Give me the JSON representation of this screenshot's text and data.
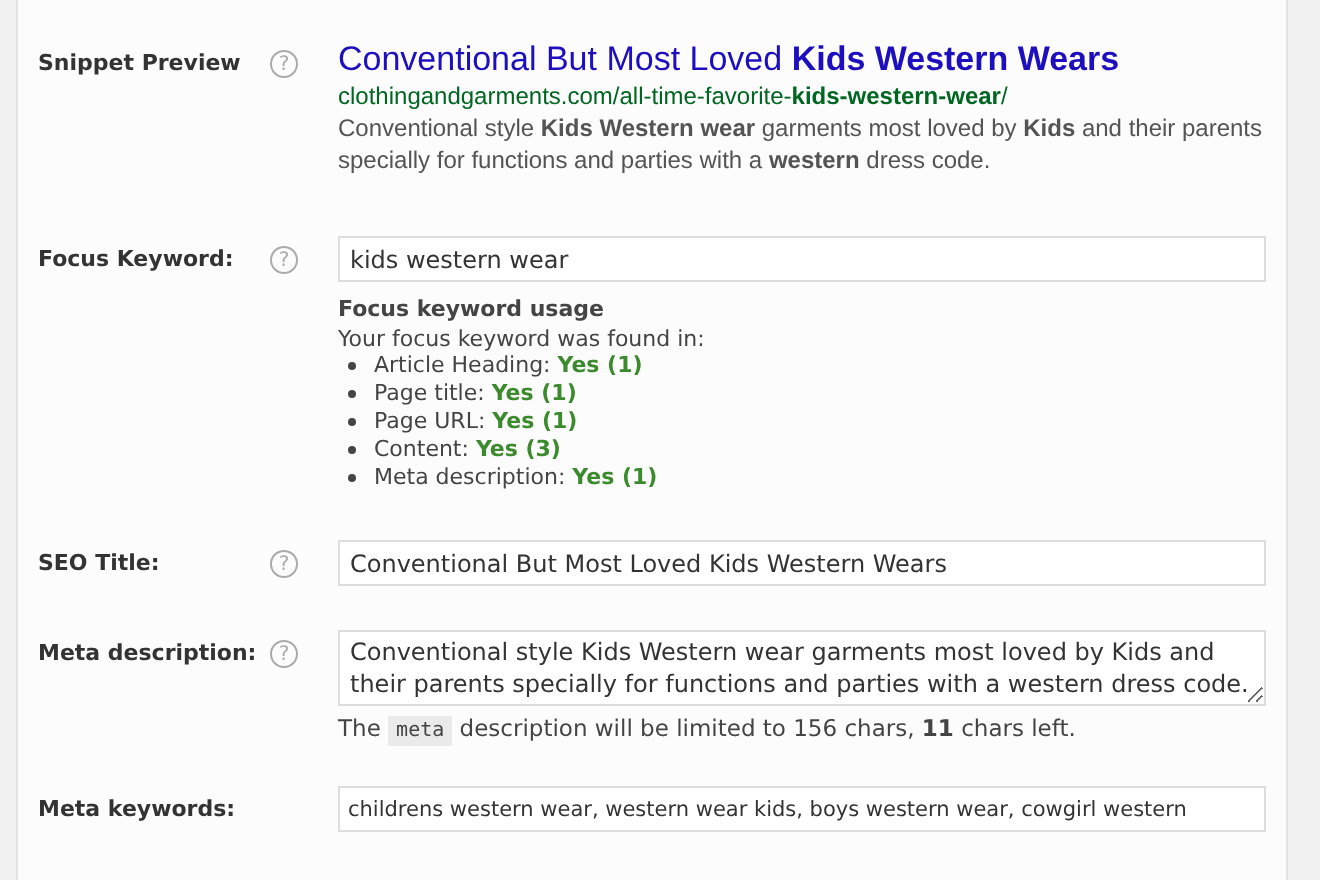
{
  "snippet_preview": {
    "label": "Snippet Preview",
    "help": "?",
    "title": "Conventional But Most Loved **Kids Western Wears**",
    "url": "clothingandgarments.com/all-time-favorite-**kids-western-wear**/",
    "description": "Conventional style **Kids Western wear** garments most loved by **Kids** and their parents specially for functions and parties with a **western** dress code."
  },
  "focus_keyword": {
    "label": "Focus Keyword:",
    "help": "?",
    "value": "kids western wear",
    "usage_heading": "Focus keyword usage",
    "usage_intro": "Your focus keyword was found in:",
    "usage": [
      {
        "label": "Article Heading:",
        "result": "Yes (1)"
      },
      {
        "label": "Page title:",
        "result": "Yes (1)"
      },
      {
        "label": "Page URL:",
        "result": "Yes (1)"
      },
      {
        "label": "Content:",
        "result": "Yes (3)"
      },
      {
        "label": "Meta description:",
        "result": "Yes (1)"
      }
    ]
  },
  "seo_title": {
    "label": "SEO Title:",
    "help": "?",
    "value": "Conventional But Most Loved Kids Western Wears"
  },
  "meta_description": {
    "label": "Meta description:",
    "help": "?",
    "value": "Conventional style Kids Western wear garments most loved by Kids and their parents specially for functions and parties with a western dress code.",
    "note_before": "The",
    "note_code": "meta",
    "note_after": "description will be limited to 156 chars, **11** chars left."
  },
  "meta_keywords": {
    "label": "Meta keywords:",
    "value": "childrens western wear, western wear kids, boys western wear, cowgirl western"
  }
}
